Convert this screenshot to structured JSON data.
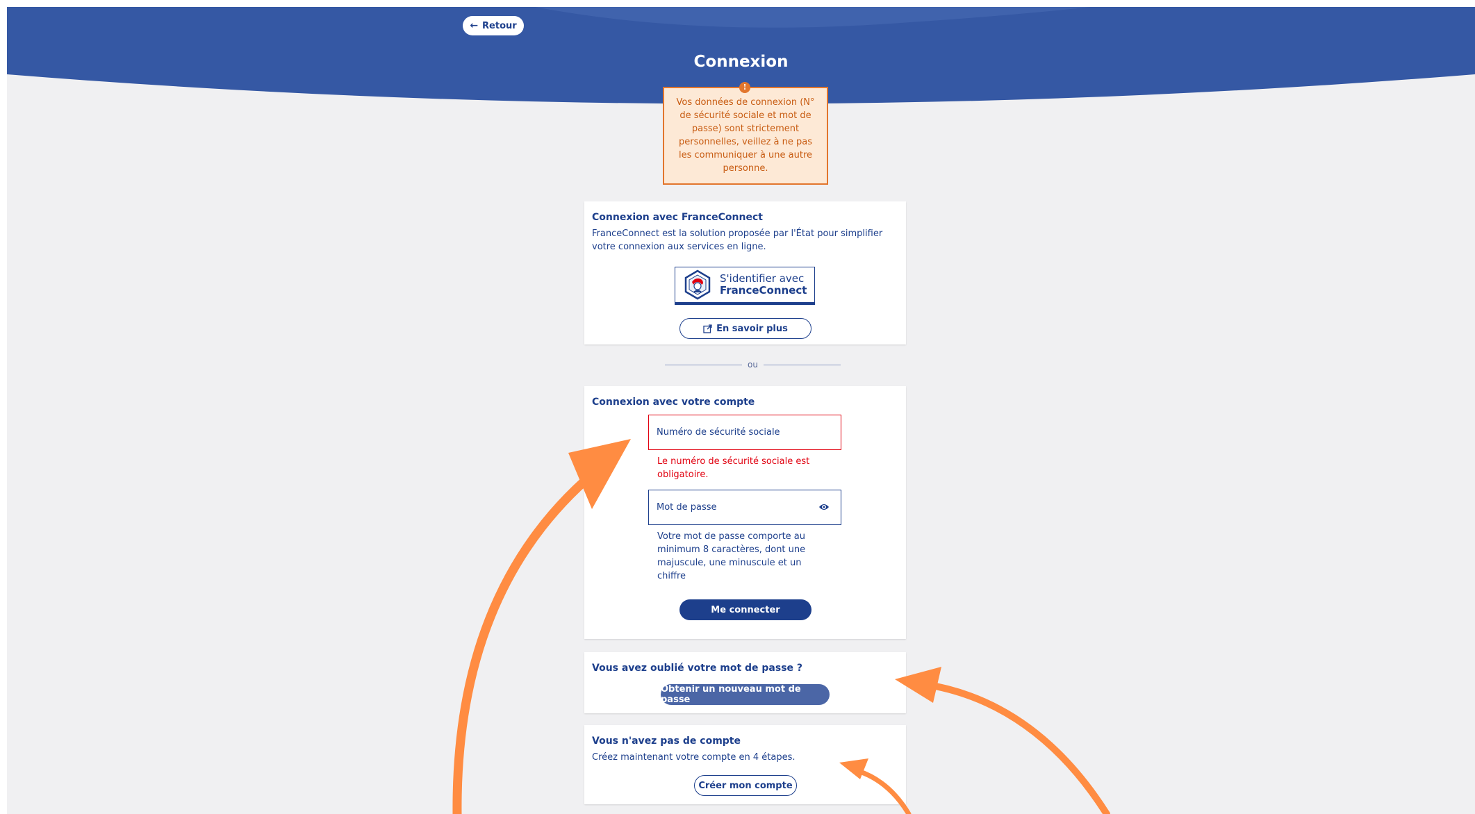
{
  "header": {
    "back_label": "Retour",
    "title": "Connexion"
  },
  "warning": {
    "icon": "info-icon",
    "text": "Vos données de connexion (N° de sécurité sociale et mot de passe) sont strictement personnelles, veillez à ne pas les communiquer à une autre personne."
  },
  "franceconnect": {
    "title": "Connexion avec FranceConnect",
    "description": "FranceConnect est la solution proposée par l'État pour simplifier votre connexion aux services en ligne.",
    "button_line1": "S'identifier avec",
    "button_line2": "FranceConnect",
    "learn_more_label": "En savoir plus",
    "learn_more_icon": "external-link-icon"
  },
  "separator": {
    "label": "ou"
  },
  "account": {
    "title": "Connexion avec votre compte",
    "nss_label": "Numéro de sécurité sociale",
    "nss_error": "Le numéro de sécurité sociale est obligatoire.",
    "password_label": "Mot de passe",
    "password_icon": "eye-icon",
    "password_hint": "Votre mot de passe comporte au minimum 8 caractères, dont une majuscule, une minuscule et un chiffre",
    "submit_label": "Me connecter"
  },
  "forgot": {
    "title": "Vous avez oublié votre mot de passe ?",
    "button_label": "Obtenir un nouveau mot de passe"
  },
  "no_account": {
    "title": "Vous n'avez pas de compte",
    "text": "Créez maintenant votre compte en 4 étapes.",
    "button_label": "Créer mon compte"
  },
  "colors": {
    "header_blue": "#3558a4",
    "primary_blue": "#1d3f8c",
    "error_red": "#e1000f",
    "warning_orange": "#e2762d",
    "annotation_orange": "#ff8c42"
  }
}
